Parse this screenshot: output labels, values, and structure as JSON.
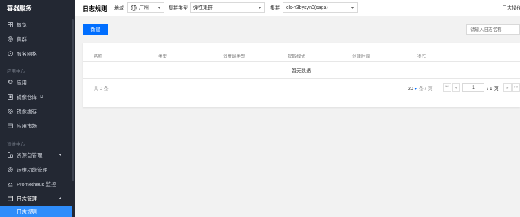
{
  "sidebar": {
    "brand": "容器服务",
    "items": [
      {
        "label": "概览",
        "icon": "grid-icon"
      },
      {
        "label": "集群",
        "icon": "cluster-icon"
      },
      {
        "label": "服务网格",
        "icon": "mesh-icon"
      }
    ],
    "group_app": "应用中心",
    "app_items": [
      {
        "label": "应用",
        "icon": "app-icon"
      },
      {
        "label": "镜像仓库",
        "icon": "image-repo-icon",
        "external": "⧉"
      },
      {
        "label": "镜像缓存",
        "icon": "cache-icon"
      },
      {
        "label": "应用市场",
        "icon": "market-icon"
      }
    ],
    "group_ops": "运维中心",
    "ops_items": [
      {
        "label": "资源包管理",
        "icon": "package-icon"
      },
      {
        "label": "运维功能管理",
        "icon": "ops-icon"
      },
      {
        "label": "Prometheus 监控",
        "icon": "monitor-icon"
      },
      {
        "label": "日志管理",
        "icon": "log-icon"
      }
    ],
    "active_sub": "日志规则"
  },
  "topbar": {
    "title": "日志规则",
    "region_label": "地域",
    "region_value": "广州",
    "cluster_type_label": "集群类型",
    "cluster_type_value": "弹性集群",
    "cluster_label": "集群",
    "cluster_value": "cls-n3bysyn0(saga)",
    "right_text": "日志操作"
  },
  "content": {
    "new_button": "新建",
    "search_placeholder": "请输入日志名称",
    "columns": [
      "名称",
      "类型",
      "消费端类型",
      "提取模式",
      "创建时间",
      "操作"
    ],
    "empty_text": "暂无数据",
    "total_text": "共 0 条",
    "page_size": "20",
    "page_size_unit": "条 / 页",
    "current_page": "1",
    "page_total": "/ 1 页"
  }
}
